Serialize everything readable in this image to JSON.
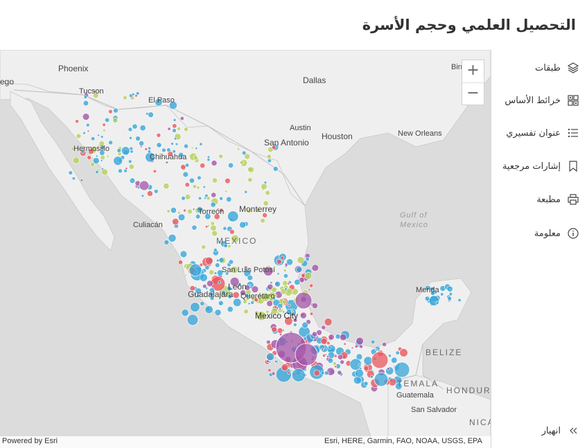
{
  "header": {
    "title": "التحصيل العلمي وحجم الأسرة"
  },
  "panel": {
    "items": [
      {
        "label": "طبقات",
        "icon": "layers-icon"
      },
      {
        "label": "خرائط الأساس",
        "icon": "basemap-gallery-icon"
      },
      {
        "label": "عنوان تفسيري",
        "icon": "legend-list-icon"
      },
      {
        "label": "إشارات مرجعية",
        "icon": "bookmark-icon"
      },
      {
        "label": "مطبعة",
        "icon": "printer-icon"
      },
      {
        "label": "معلومة",
        "icon": "info-icon"
      }
    ],
    "collapse": {
      "label": "انهيار",
      "icon": "double-chevron-icon"
    }
  },
  "map": {
    "zoom_in": "+",
    "zoom_out": "−",
    "labels": {
      "phoenix": "Phoenix",
      "ego": "ego",
      "tucson": "Tucson",
      "elpaso": "El Paso",
      "dallas": "Dallas",
      "birm": "Birm",
      "austin": "Austin",
      "houston": "Houston",
      "sanantonio": "San Antonio",
      "neworleans": "New Orleans",
      "hermosillo": "Hermosillo",
      "chihuahua": "Chihuahua",
      "torreon": "Torreón",
      "monterrey": "Monterrey",
      "culiacan": "Culiacán",
      "gulf1": "Gulf of",
      "gulf2": "Mexico",
      "mexico": "MEXICO",
      "sanluis": "San Luis Potosí",
      "leon": "León",
      "queretaro": "Querétaro",
      "guadalajara": "Guadalajara",
      "mexicocity": "Mexico City",
      "merida": "Merida",
      "belize": "BELIZE",
      "temala": "TEMALA",
      "guatemala": "Guatemala",
      "hondur": "HONDUR",
      "sansalvador": "San Salvador",
      "nica": "NICA"
    },
    "attribution": {
      "left": "Powered by Esri",
      "right": "Esri, HERE, Garmin, FAO, NOAA, USGS, EPA"
    },
    "colors": {
      "blue": "#3aa6d8",
      "purple": "#a456a8",
      "red": "#e8585e",
      "green": "#b6cf5e",
      "land": "#efefef",
      "water": "#d4d4d4"
    }
  }
}
